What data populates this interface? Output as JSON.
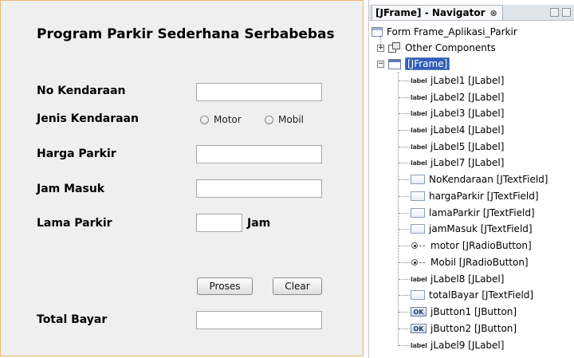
{
  "form": {
    "title": "Program Parkir Sederhana Serbabebas",
    "labels": {
      "no_kendaraan": "No Kendaraan",
      "jenis_kendaraan": "Jenis Kendaraan",
      "harga_parkir": "Harga Parkir",
      "jam_masuk": "Jam Masuk",
      "lama_parkir": "Lama Parkir",
      "jam_unit": "Jam",
      "total_bayar": "Total Bayar"
    },
    "radio": {
      "motor": "Motor",
      "mobil": "Mobil"
    },
    "buttons": {
      "proses": "Proses",
      "clear": "Clear"
    },
    "fields": {
      "no_kendaraan": "",
      "harga_parkir": "",
      "jam_masuk": "",
      "lama_parkir": "",
      "total_bayar": ""
    }
  },
  "navigator": {
    "tab_title": "[JFrame] - Navigator",
    "tab_close": "⊗",
    "tree": [
      {
        "text": "Form Frame_Aplikasi_Parkir",
        "icon": "form-icon"
      },
      {
        "text": "Other Components",
        "icon": "other-components-icon"
      },
      {
        "text": "[JFrame]",
        "icon": "jframe-icon"
      },
      {
        "text": "jLabel1 [JLabel]",
        "icon": "label-icon"
      },
      {
        "text": "jLabel2 [JLabel]",
        "icon": "label-icon"
      },
      {
        "text": "jLabel3 [JLabel]",
        "icon": "label-icon"
      },
      {
        "text": "jLabel4 [JLabel]",
        "icon": "label-icon"
      },
      {
        "text": "jLabel5 [JLabel]",
        "icon": "label-icon"
      },
      {
        "text": "jLabel7 [JLabel]",
        "icon": "label-icon"
      },
      {
        "text": "NoKendaraan [JTextField]",
        "icon": "textfield-icon"
      },
      {
        "text": "hargaParkir [JTextField]",
        "icon": "textfield-icon"
      },
      {
        "text": "lamaParkir [JTextField]",
        "icon": "textfield-icon"
      },
      {
        "text": "jamMasuk [JTextField]",
        "icon": "textfield-icon"
      },
      {
        "text": "motor [JRadioButton]",
        "icon": "radiobutton-icon"
      },
      {
        "text": "Mobil [JRadioButton]",
        "icon": "radiobutton-icon"
      },
      {
        "text": "jLabel8 [JLabel]",
        "icon": "label-icon"
      },
      {
        "text": "totalBayar [JTextField]",
        "icon": "textfield-icon"
      },
      {
        "text": "jButton1 [JButton]",
        "icon": "button-icon"
      },
      {
        "text": "jButton2 [JButton]",
        "icon": "button-icon"
      },
      {
        "text": "jLabel9 [JLabel]",
        "icon": "label-icon"
      }
    ],
    "icon_text": {
      "label": "label",
      "button": "OK"
    },
    "expanders": {
      "plus": "+",
      "minus": "−"
    }
  },
  "colors": {
    "form_border": "#e9b96e",
    "selection": "#2f5fb8"
  }
}
